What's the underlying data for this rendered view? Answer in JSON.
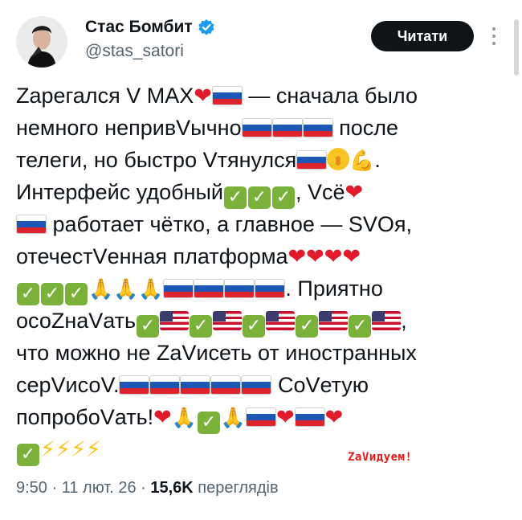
{
  "author": {
    "name": "Стас Бомбит",
    "handle": "@stas_satori",
    "verified_color": "#1d9bf0"
  },
  "header": {
    "read_button_label": "Читати",
    "more_icon": "vertical-ellipsis-icon"
  },
  "tweet": {
    "text": [
      "Zaрегался V MAX",
      " — сначала было",
      "немного непривVычно",
      " после",
      "телеги, но быстро Vтянулся",
      ".",
      "Интерфейс удобный",
      ", Vсё",
      " работает чётко, а главное — SVOя,",
      "отечестVенная платформа",
      ". Приятно",
      "осоZнаVать",
      ",",
      "что можно не ZaVисеть от иностранных",
      "серVисоV.",
      " CoVетую",
      "попробоVать!"
    ]
  },
  "watermark": "ZаVидуем!",
  "meta": {
    "time": "9:50",
    "sep1": " · ",
    "date": "11 лют. 26",
    "sep2": " · ",
    "views_count": "15,6K",
    "views_label": " переглядів"
  },
  "colors": {
    "text": "#0f1419",
    "secondary": "#536471",
    "button_bg": "#0f1419",
    "heart": "#e21b2c",
    "check_bg": "#79b13b"
  }
}
